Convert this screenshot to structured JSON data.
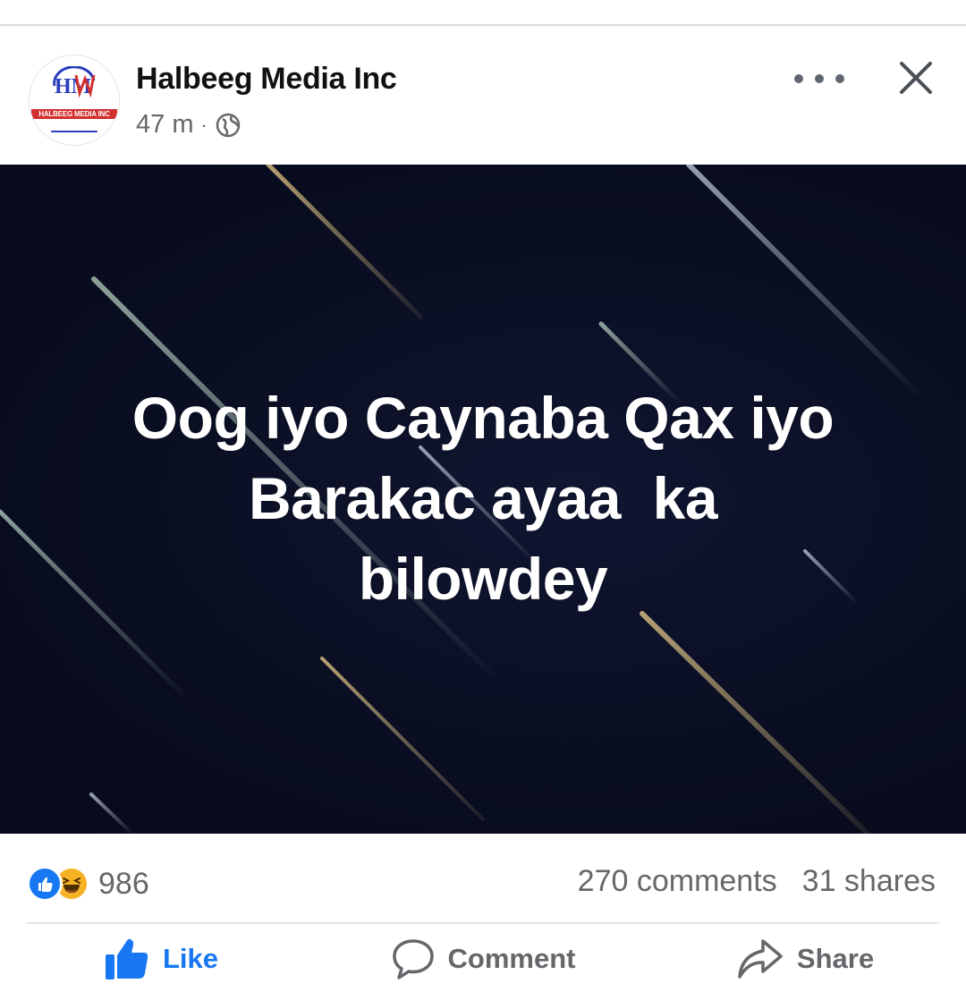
{
  "post": {
    "page_name": "Halbeeg Media Inc",
    "time_ago": "47 m",
    "separator": "·",
    "privacy_icon": "globe-icon",
    "avatar": {
      "logo_letters": "HM",
      "banner_text": "HALBEEG MEDIA INC"
    },
    "header_actions": {
      "more_icon": "more-dots-icon",
      "close_icon": "close-icon"
    },
    "image_text": [
      "Oog iyo Caynaba Qax iyo",
      "Barakac ayaa  ka",
      "bilowdey"
    ]
  },
  "stats": {
    "reaction_icons": [
      "like-reaction-icon",
      "haha-reaction-icon"
    ],
    "reaction_count": "986",
    "comments": "270 comments",
    "shares": "31 shares"
  },
  "actions": {
    "like": "Like",
    "comment": "Comment",
    "share": "Share"
  },
  "colors": {
    "brand_blue": "#1877f2",
    "secondary_text": "#65676b",
    "image_background": "#0a0e22",
    "haha_yellow": "#f7b125",
    "logo_red": "#d32f2f"
  }
}
